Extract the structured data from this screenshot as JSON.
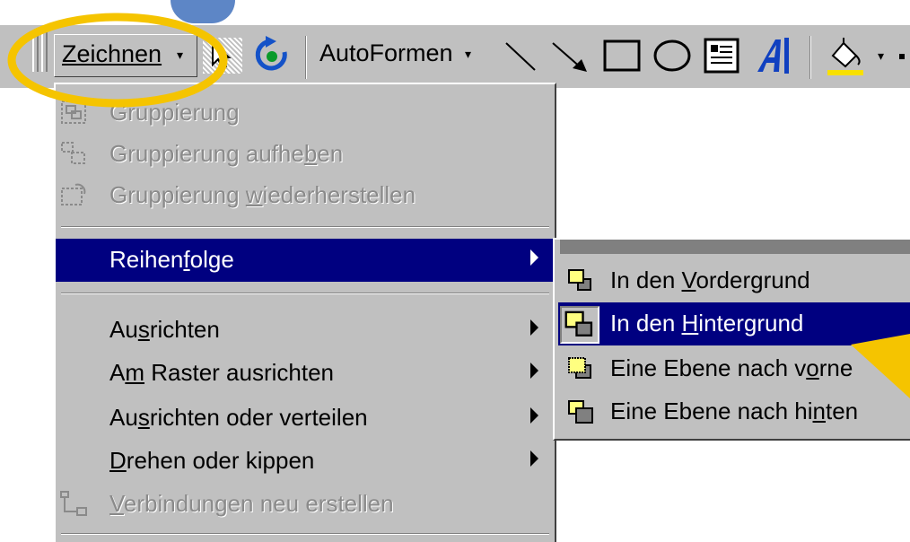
{
  "toolbar": {
    "zeichnen_label": "Zeichnen",
    "autoformen_label": "AutoFormen",
    "dropdown_arrow": "▾",
    "icons": [
      "select-pointer-icon",
      "free-rotate-icon",
      "line-icon",
      "arrow-icon",
      "rectangle-icon",
      "oval-icon",
      "text-box-icon",
      "wordart-icon",
      "fill-color-icon"
    ]
  },
  "menu": {
    "items": [
      {
        "pre": "Gruppierung",
        "acc": "",
        "post": "",
        "disabled": true
      },
      {
        "pre": "Gruppierung aufhe",
        "acc": "b",
        "post": "en",
        "disabled": true
      },
      {
        "pre": "Gruppierung ",
        "acc": "w",
        "post": "iederherstellen",
        "disabled": true
      },
      {
        "pre": "Reihen",
        "acc": "f",
        "post": "olge",
        "submenu": true
      },
      {
        "pre": "Au",
        "acc": "s",
        "post": "richten",
        "submenu": true
      },
      {
        "pre": "A",
        "acc": "m",
        "post": " Raster ausrichten",
        "submenu": true
      },
      {
        "pre": "Au",
        "acc": "s",
        "post": "richten oder verteilen",
        "submenu": true
      },
      {
        "pre": "",
        "acc": "D",
        "post": "rehen oder kippen",
        "submenu": true
      },
      {
        "pre": "",
        "acc": "V",
        "post": "erbindungen neu erstellen",
        "disabled": true
      }
    ]
  },
  "submenu": {
    "items": [
      {
        "pre": "In den ",
        "acc": "V",
        "post": "ordergrund"
      },
      {
        "pre": "In den ",
        "acc": "H",
        "post": "intergrund"
      },
      {
        "pre": "Eine Ebene nach v",
        "acc": "o",
        "post": "rne"
      },
      {
        "pre": "Eine Ebene nach hi",
        "acc": "n",
        "post": "ten"
      }
    ]
  },
  "colors": {
    "highlight": "#000080",
    "annotation": "#f5c400",
    "menu_bg": "#c0c0c0"
  }
}
